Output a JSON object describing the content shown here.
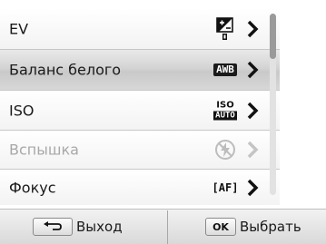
{
  "menu": {
    "items": [
      {
        "label": "EV",
        "value_icon": "ev-compensation-icon",
        "enabled": true,
        "selected": false
      },
      {
        "label": "Баланс белого",
        "value_icon": "white-balance-auto-icon",
        "badge": "AWB",
        "enabled": true,
        "selected": true
      },
      {
        "label": "ISO",
        "value_icon": "iso-auto-icon",
        "iso_top": "ISO",
        "iso_bottom": "AUTO",
        "enabled": true,
        "selected": false
      },
      {
        "label": "Вспышка",
        "value_icon": "flash-off-icon",
        "enabled": false,
        "selected": false
      },
      {
        "label": "Фокус",
        "value_icon": "autofocus-icon",
        "af": "[AF]",
        "enabled": true,
        "selected": false
      }
    ]
  },
  "softkeys": {
    "back": {
      "icon": "back-arrow-icon",
      "label": "Выход"
    },
    "ok": {
      "key": "OK",
      "label": "Выбрать"
    }
  },
  "colors": {
    "selected_row": "#d0d0d0",
    "disabled_text": "#a8a8a8",
    "text": "#1a1a1a"
  }
}
